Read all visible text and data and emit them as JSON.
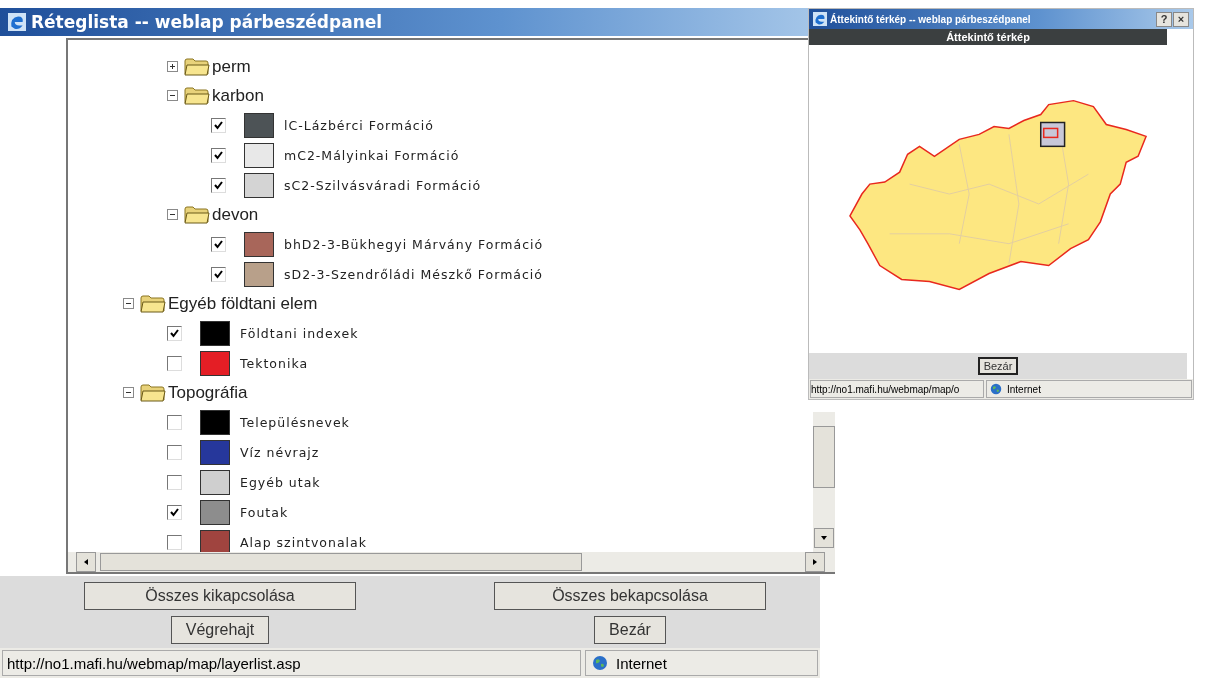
{
  "main_window": {
    "title": "Réteglista -- weblap párbeszédpanel"
  },
  "tree": [
    {
      "children": [
        {
          "kind": "folder",
          "label": "perm",
          "expanded": false
        },
        {
          "kind": "folder",
          "label": "karbon",
          "expanded": true,
          "children": [
            {
              "kind": "layer",
              "label": "lC-Lázbérci Formáció",
              "checked": true,
              "color": "#4d5356"
            },
            {
              "kind": "layer",
              "label": "mC2-Mályinkai Formáció",
              "checked": true,
              "color": "#e8e8e8"
            },
            {
              "kind": "layer",
              "label": "sC2-Szilvásváradi Formáció",
              "checked": true,
              "color": "#d4d4d4"
            }
          ]
        },
        {
          "kind": "folder",
          "label": "devon",
          "expanded": true,
          "children": [
            {
              "kind": "layer",
              "label": "bhD2-3-Bükhegyi Márvány Formáció",
              "checked": true,
              "color": "#a8665a"
            },
            {
              "kind": "layer",
              "label": "sD2-3-Szendrőládi Mészkő Formáció",
              "checked": true,
              "color": "#b8a08a"
            }
          ]
        }
      ]
    },
    {
      "kind": "folder",
      "label": "Egyéb földtani elem",
      "expanded": true,
      "children": [
        {
          "kind": "layer",
          "label": "Földtani indexek",
          "checked": true,
          "color": "#000000"
        },
        {
          "kind": "layer",
          "label": "Tektonika",
          "checked": false,
          "color": "#e41e25"
        }
      ]
    },
    {
      "kind": "folder",
      "label": "Topográfia",
      "expanded": true,
      "children": [
        {
          "kind": "layer",
          "label": "Településnevek",
          "checked": false,
          "color": "#000000"
        },
        {
          "kind": "layer",
          "label": "Víz névrajz",
          "checked": false,
          "color": "#26379b"
        },
        {
          "kind": "layer",
          "label": "Egyéb utak",
          "checked": false,
          "color": "#cfcfcf"
        },
        {
          "kind": "layer",
          "label": "Foutak",
          "checked": true,
          "color": "#8d8d8d"
        },
        {
          "kind": "layer",
          "label": "Alap szintvonalak",
          "checked": false,
          "color": "#a0443f"
        }
      ]
    }
  ],
  "buttons": [
    "Összes kikapcsolása",
    "Összes bekapcsolása",
    "Végrehajt",
    "Bezár"
  ],
  "status_bar": {
    "url": "http://no1.mafi.hu/webmap/map/layerlist.asp",
    "zone": "Internet"
  },
  "overview_window": {
    "title": "Áttekintő térkép -- weblap párbeszédpanel",
    "title_buttons": [
      "?",
      "×"
    ],
    "header": "Áttekintő térkép",
    "button": "Bezár",
    "status_bar": {
      "url": "http://no1.mafi.hu/webmap/map/o",
      "zone": "Internet"
    }
  }
}
